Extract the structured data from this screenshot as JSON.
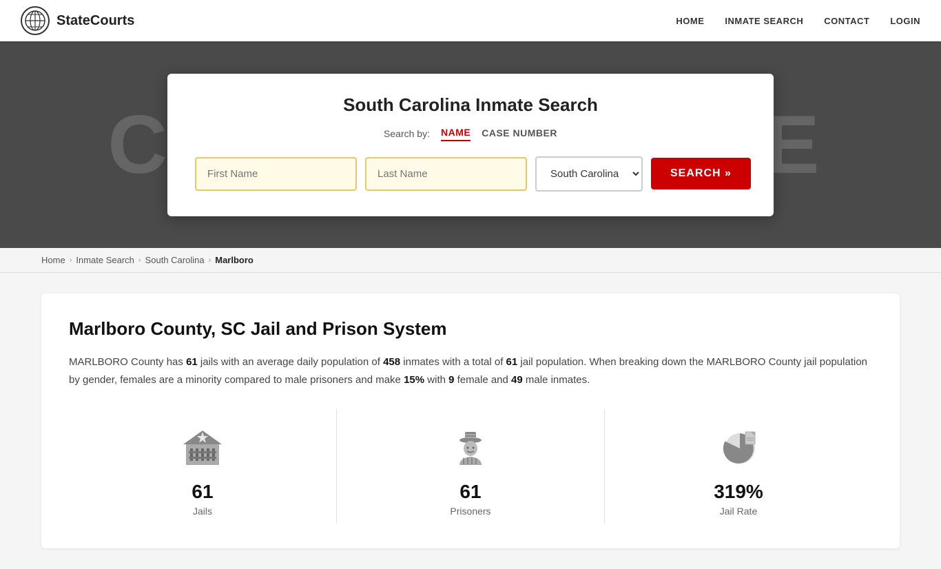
{
  "header": {
    "logo_text": "StateCourts",
    "nav": {
      "home": "HOME",
      "inmate_search": "INMATE SEARCH",
      "contact": "CONTACT",
      "login": "LOGIN"
    }
  },
  "hero": {
    "bg_text": "COURTHOUSE",
    "search_card": {
      "title": "South Carolina Inmate Search",
      "search_by_label": "Search by:",
      "tab_name": "NAME",
      "tab_case": "CASE NUMBER",
      "first_name_placeholder": "First Name",
      "last_name_placeholder": "Last Name",
      "state_value": "South Carolina",
      "search_button": "SEARCH »"
    }
  },
  "breadcrumb": {
    "home": "Home",
    "inmate_search": "Inmate Search",
    "south_carolina": "South Carolina",
    "current": "Marlboro"
  },
  "main": {
    "title": "Marlboro County, SC Jail and Prison System",
    "description_parts": {
      "prefix": "MARLBORO County has ",
      "jails_count": "61",
      "mid1": " jails with an average daily population of ",
      "pop_count": "458",
      "mid2": " inmates with a total of ",
      "total_jails": "61",
      "mid3": " jail population. When breaking down the MARLBORO County jail population by gender, females are a minority compared to male prisoners and make ",
      "female_pct": "15%",
      "mid4": " with ",
      "female_count": "9",
      "mid5": " female and ",
      "male_count": "49",
      "suffix": " male inmates."
    },
    "stats": [
      {
        "icon": "jails-icon",
        "number": "61",
        "label": "Jails"
      },
      {
        "icon": "prisoners-icon",
        "number": "61",
        "label": "Prisoners"
      },
      {
        "icon": "jail-rate-icon",
        "number": "319%",
        "label": "Jail Rate"
      }
    ]
  }
}
